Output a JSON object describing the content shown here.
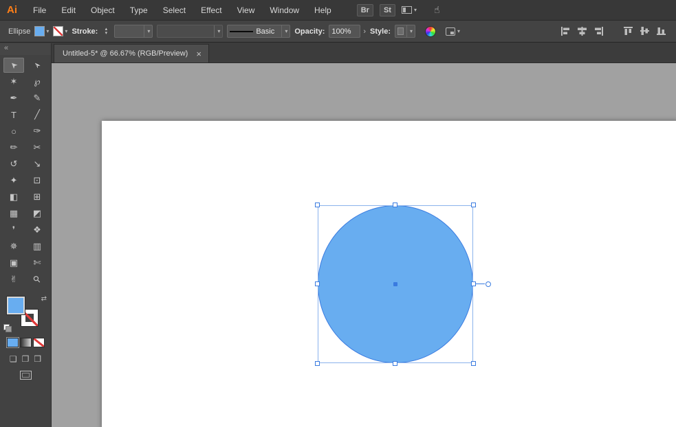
{
  "colors": {
    "fill_blue": "#68adf0",
    "selection_blue": "#3a7be0",
    "bbox_blue": "#8ab2ec",
    "canvas_gray": "#a1a1a1"
  },
  "icons": {
    "chevron_down": "▾",
    "step_up": "▴",
    "step_down": "▾",
    "flyout": "›",
    "swap": "⇄",
    "touch": "☝"
  },
  "menubar": {
    "logo": "Ai",
    "items": [
      {
        "name": "menu-file",
        "label": "File"
      },
      {
        "name": "menu-edit",
        "label": "Edit"
      },
      {
        "name": "menu-object",
        "label": "Object"
      },
      {
        "name": "menu-type",
        "label": "Type"
      },
      {
        "name": "menu-select",
        "label": "Select"
      },
      {
        "name": "menu-effect",
        "label": "Effect"
      },
      {
        "name": "menu-view",
        "label": "View"
      },
      {
        "name": "menu-window",
        "label": "Window"
      },
      {
        "name": "menu-help",
        "label": "Help"
      }
    ],
    "bridge_label": "Br",
    "stock_label": "St"
  },
  "controlbar": {
    "tool_label": "Ellipse",
    "stroke_label": "Stroke:",
    "stroke_weight_value": "",
    "brush_label": "Basic",
    "opacity_label": "Opacity:",
    "opacity_value": "100%",
    "style_label": "Style:"
  },
  "tabbar": {
    "title": "Untitled-5* @ 66.67% (RGB/Preview)",
    "close_label": "×"
  },
  "toolbar": {
    "collapse_label": "«",
    "tools": [
      {
        "name": "selection-tool",
        "glyph": "➤",
        "cls": "cursor",
        "selected": true
      },
      {
        "name": "direct-selection-tool",
        "glyph": "➢",
        "cls": "cursor2"
      },
      {
        "name": "magic-wand-tool",
        "glyph": "✶"
      },
      {
        "name": "lasso-tool",
        "glyph": "℘"
      },
      {
        "name": "pen-tool",
        "glyph": "✒"
      },
      {
        "name": "curvature-tool",
        "glyph": "✎"
      },
      {
        "name": "type-tool",
        "glyph": "T"
      },
      {
        "name": "line-segment-tool",
        "glyph": "╱"
      },
      {
        "name": "ellipse-tool",
        "glyph": "○"
      },
      {
        "name": "paintbrush-tool",
        "glyph": "✑"
      },
      {
        "name": "pencil-tool",
        "glyph": "✏"
      },
      {
        "name": "scissors-tool",
        "glyph": "✂"
      },
      {
        "name": "rotate-tool",
        "glyph": "↺"
      },
      {
        "name": "scale-tool",
        "glyph": "↘"
      },
      {
        "name": "width-tool",
        "glyph": "✦"
      },
      {
        "name": "free-transform-tool",
        "glyph": "⊡"
      },
      {
        "name": "shape-builder-tool",
        "glyph": "◧"
      },
      {
        "name": "perspective-grid-tool",
        "glyph": "⊞"
      },
      {
        "name": "mesh-tool",
        "glyph": "▦"
      },
      {
        "name": "gradient-tool",
        "glyph": "◩"
      },
      {
        "name": "eyedropper-tool",
        "glyph": "❜"
      },
      {
        "name": "blend-tool",
        "glyph": "❖"
      },
      {
        "name": "symbol-sprayer-tool",
        "glyph": "✵"
      },
      {
        "name": "column-graph-tool",
        "glyph": "▥"
      },
      {
        "name": "artboard-tool",
        "glyph": "▣"
      },
      {
        "name": "slice-tool",
        "glyph": "✄"
      },
      {
        "name": "hand-tool",
        "glyph": "✌"
      },
      {
        "name": "zoom-tool",
        "glyph": "⚲",
        "cls": "zoomrot"
      }
    ],
    "color_buttons": [
      {
        "name": "color-button",
        "cls": "c-color"
      },
      {
        "name": "gradient-button",
        "cls": "c-grad"
      },
      {
        "name": "none-button",
        "cls": "c-none"
      }
    ],
    "draw_modes": [
      {
        "name": "draw-normal-button",
        "glyph": "❏"
      },
      {
        "name": "draw-behind-button",
        "glyph": "❐"
      },
      {
        "name": "draw-inside-button",
        "glyph": "❒"
      }
    ]
  },
  "canvas": {
    "shape": "ellipse",
    "zoom": "66.67%",
    "color_mode": "RGB/Preview"
  }
}
